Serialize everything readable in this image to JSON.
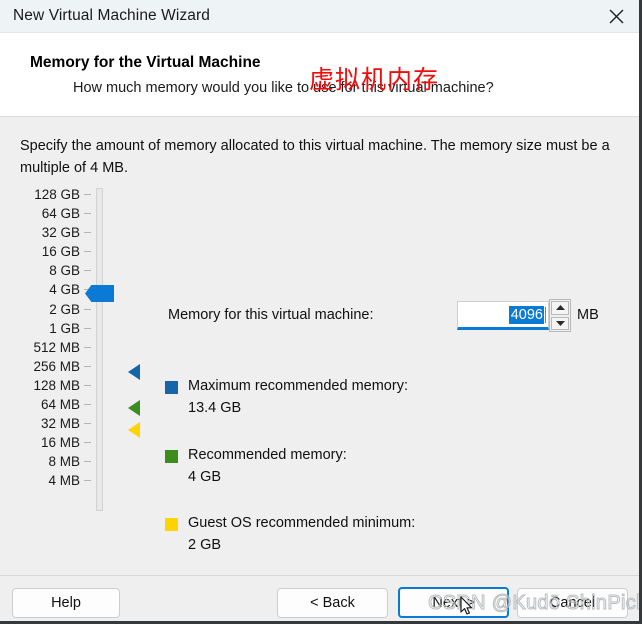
{
  "window": {
    "title": "New Virtual Machine Wizard",
    "close_icon": "close-icon"
  },
  "header": {
    "title": "Memory for the Virtual Machine",
    "subtitle": "How much memory would you like to use for this virtual machine?",
    "annotation_cn": "虚拟机内存"
  },
  "body": {
    "intro": "Specify the amount of memory allocated to this virtual machine. The memory size must be a multiple of 4 MB.",
    "memory_label": "Memory for this virtual machine:",
    "memory_value": "4096",
    "memory_unit": "MB",
    "spinner_up_icon": "chevron-up-icon",
    "spinner_down_icon": "chevron-down-icon"
  },
  "slider": {
    "scale": [
      "128 GB",
      "64 GB",
      "32 GB",
      "16 GB",
      "8 GB",
      "4 GB",
      "2 GB",
      "1 GB",
      "512 MB",
      "256 MB",
      "128 MB",
      "64 MB",
      "32 MB",
      "16 MB",
      "8 MB",
      "4 MB"
    ],
    "current_position_label": "4 GB",
    "thumb_color": "#0b7ad4",
    "markers": [
      {
        "name": "maximum-recommended",
        "color": "#1565a8"
      },
      {
        "name": "recommended",
        "color": "#3d8c1e"
      },
      {
        "name": "guest-os-minimum",
        "color": "#ffd400"
      }
    ]
  },
  "legend": [
    {
      "key": "maximum",
      "title": "Maximum recommended memory:",
      "value": "13.4 GB",
      "color": "#1565a8"
    },
    {
      "key": "recommended",
      "title": "Recommended memory:",
      "value": "4 GB",
      "color": "#3d8c1e"
    },
    {
      "key": "guest",
      "title": "Guest OS recommended minimum:",
      "value": "2 GB",
      "color": "#ffd400"
    }
  ],
  "footer": {
    "help": "Help",
    "back": "< Back",
    "next": "Next >",
    "cancel": "Cancel"
  },
  "overlay": {
    "watermark": "CSDN @Kudō ShinPichi"
  }
}
